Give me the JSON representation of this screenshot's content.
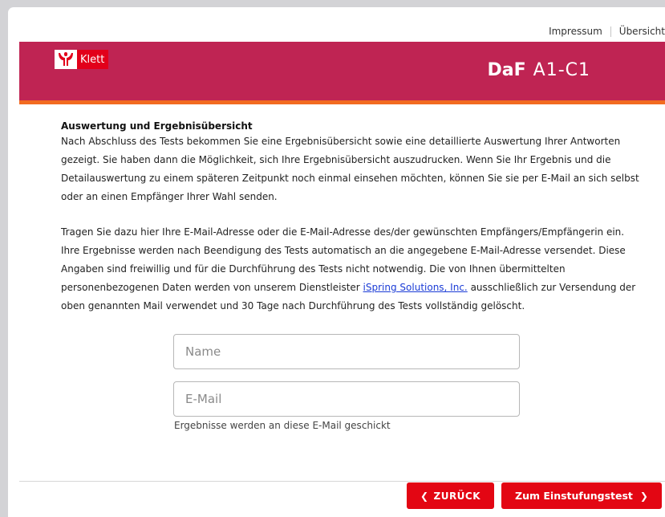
{
  "nav": {
    "impressum": "Impressum",
    "uebersicht": "Übersicht"
  },
  "header": {
    "logo_text": "Klett",
    "brand_daf": "DaF",
    "brand_level": "A1-C1"
  },
  "colors": {
    "banner": "#bf2453",
    "accent_stripe": "#f26b21",
    "button": "#e30613",
    "link": "#1a3bd6"
  },
  "content": {
    "title": "Auswertung und Ergebnisübersicht",
    "paragraph1": "Nach Abschluss des Tests bekommen Sie eine Ergebnisübersicht sowie eine detaillierte Auswertung Ihrer Antworten gezeigt. Sie haben dann die Möglichkeit, sich Ihre Ergebnisübersicht auszudrucken. Wenn Sie Ihr Ergebnis und die Detailauswertung zu einem späteren Zeitpunkt noch einmal einsehen möchten, können Sie sie per E-Mail an sich selbst oder an einen Empfänger Ihrer Wahl senden.",
    "paragraph2_before_link": "Tragen Sie dazu hier Ihre E-Mail-Adresse oder die E-Mail-Adresse des/der gewünschten Empfängers/Empfängerin ein. Ihre Ergebnisse werden nach Beendigung des Tests automatisch an die angegebene E-Mail-Adresse versendet. Diese Angaben sind freiwillig und für die Durchführung des Tests nicht notwendig. Die von Ihnen übermittelten personenbezogenen Daten werden von unserem Dienstleister ",
    "link_text": "iSpring Solutions, Inc.",
    "paragraph2_after_link": " ausschließlich zur Versendung der oben genannten Mail verwendet und 30 Tage nach Durchführung des Tests vollständig gelöscht."
  },
  "form": {
    "name_placeholder": "Name",
    "name_value": "",
    "email_placeholder": "E-Mail",
    "email_value": "",
    "email_hint": "Ergebnisse werden an diese E-Mail geschickt"
  },
  "buttons": {
    "back_label": "ZURÜCK",
    "next_label": "Zum Einstufungstest"
  },
  "icons": {
    "back": "chevron-left-icon",
    "next": "chevron-right-icon",
    "logo": "klett-logo-icon"
  }
}
